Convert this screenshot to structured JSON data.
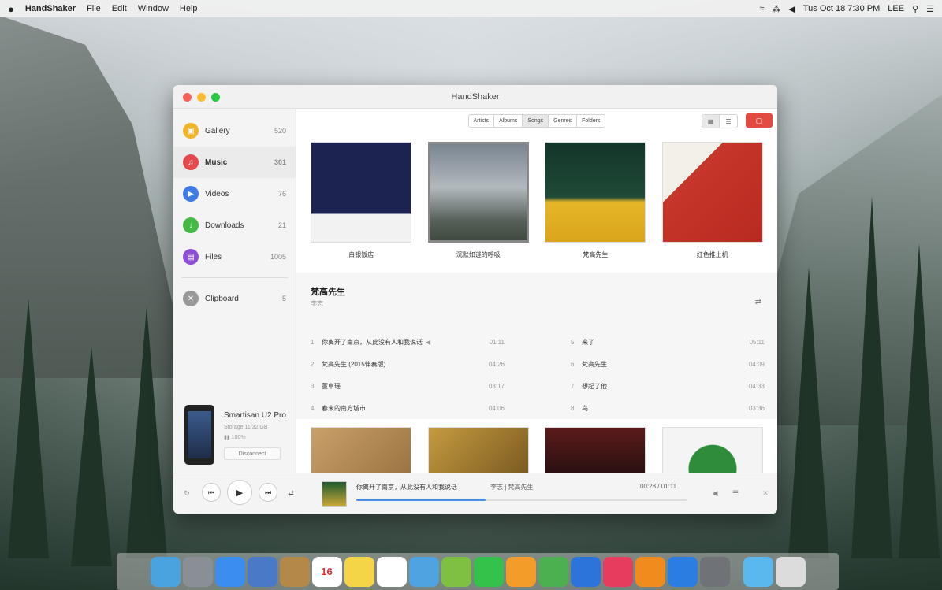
{
  "menubar": {
    "apple": "",
    "app_name": "HandShaker",
    "items": [
      "File",
      "Edit",
      "Window",
      "Help"
    ],
    "datetime": "Tus Oct 18 7:30 PM",
    "user": "LEE"
  },
  "window": {
    "title": "HandShaker"
  },
  "sidebar": {
    "items": [
      {
        "label": "Gallery",
        "count": "520",
        "color": "#f0b429",
        "icon": "gallery-icon"
      },
      {
        "label": "Music",
        "count": "301",
        "color": "#e5484d",
        "icon": "music-note-icon"
      },
      {
        "label": "Videos",
        "count": "76",
        "color": "#3e7be6",
        "icon": "play-icon"
      },
      {
        "label": "Downloads",
        "count": "21",
        "color": "#45b845",
        "icon": "download-icon"
      },
      {
        "label": "Files",
        "count": "1005",
        "color": "#8c4fd6",
        "icon": "file-icon"
      },
      {
        "label": "Clipboard",
        "count": "5",
        "color": "#999999",
        "icon": "clipboard-icon"
      }
    ],
    "device": {
      "name": "Smartisan U2 Pro",
      "storage": "Storage 11/32 GB",
      "battery": "100%",
      "disconnect": "Disconnect"
    }
  },
  "toolbar": {
    "tabs": [
      "Artists",
      "Albums",
      "Songs",
      "Genres",
      "Folders"
    ],
    "active_tab": "Songs"
  },
  "albums": [
    "白银饭店",
    "沉默如谜的呼吸",
    "梵高先生",
    "红色推土机"
  ],
  "detail": {
    "title": "梵高先生",
    "artist": "李志",
    "tracks_left": [
      {
        "num": "1",
        "title": "你离开了南京，从此没有人和我说话",
        "duration": "01:11"
      },
      {
        "num": "2",
        "title": "梵高先生 (2015伴奏版)",
        "duration": "04:26"
      },
      {
        "num": "3",
        "title": "董卓瑶",
        "duration": "03:17"
      },
      {
        "num": "4",
        "title": "春末的南方城市",
        "duration": "04:06"
      }
    ],
    "tracks_right": [
      {
        "num": "5",
        "title": "来了",
        "duration": "05:11"
      },
      {
        "num": "6",
        "title": "梵高先生",
        "duration": "04:09"
      },
      {
        "num": "7",
        "title": "想起了他",
        "duration": "04:33"
      },
      {
        "num": "8",
        "title": "鸟",
        "duration": "03:36"
      }
    ]
  },
  "player": {
    "now_playing": "你离开了南京，从此没有人和我说话",
    "artist_album": "李志 | 梵高先生",
    "time": "00:28 / 01:11",
    "progress": 0.39
  },
  "dock": {
    "icons": [
      "finder-icon",
      "launchpad-icon",
      "safari-icon",
      "preview-icon",
      "contacts-icon",
      "calendar-icon",
      "notes-icon",
      "reminders-icon",
      "photos-icon",
      "android-icon",
      "facetime-icon",
      "pages-icon",
      "numbers-icon",
      "keynote-icon",
      "itunes-icon",
      "ibooks-icon",
      "appstore-icon",
      "system-preferences-icon",
      "folder-icon",
      "trash-icon"
    ],
    "colors": [
      "#4aa3df",
      "#8a8f96",
      "#3b8ef0",
      "#4a79c8",
      "#b48848",
      "#ffffff",
      "#f5d548",
      "#ffffff",
      "#4fa3e0",
      "#7dc042",
      "#34c24a",
      "#f39c29",
      "#4caf50",
      "#2d74da",
      "#e73c5e",
      "#f08c1e",
      "#2a7de1",
      "#6f7378",
      "#5ab8ef",
      "#dcdcdc"
    ],
    "calendar_day": "16"
  }
}
